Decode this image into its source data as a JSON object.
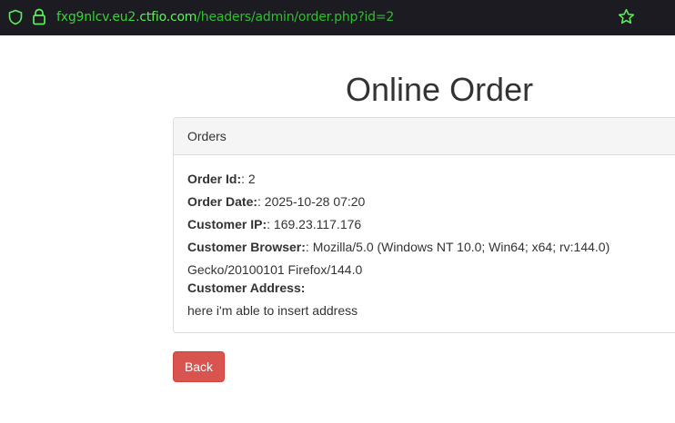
{
  "browser": {
    "url_host_prefix": "fxg9nlcv.eu2.",
    "url_domain": "ctfio.com",
    "url_path": "/headers/admin/order.php?id=2",
    "icons": [
      "shield-icon",
      "lock-icon",
      "star-icon"
    ],
    "accent_color": "#2fbf2f"
  },
  "page": {
    "title": "Online Order"
  },
  "panel": {
    "heading": "Orders",
    "fields": [
      {
        "label": "Order Id:",
        "value": ": 2"
      },
      {
        "label": "Order Date:",
        "value": ": 2025-10-28 07:20"
      },
      {
        "label": "Customer IP:",
        "value": ": 169.23.117.176"
      },
      {
        "label": "Customer Browser:",
        "value": ": Mozilla/5.0 (Windows NT 10.0; Win64; x64; rv:144.0)"
      },
      {
        "label": "",
        "value": "Gecko/20100101 Firefox/144.0"
      },
      {
        "label": "Customer Address:",
        "value": ""
      },
      {
        "label": "",
        "value": "here i'm able to insert address"
      }
    ]
  },
  "actions": {
    "back_label": "Back",
    "back_color": "#d9534f"
  }
}
